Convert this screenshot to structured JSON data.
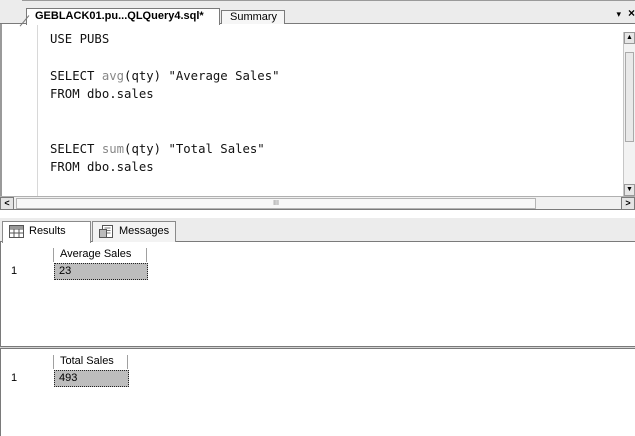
{
  "tabs": {
    "active": "GEBLACK01.pu...QLQuery4.sql*",
    "inactive": "Summary",
    "dropdown_glyph": "▾",
    "close_glyph": "×"
  },
  "editor": {
    "lines": [
      [
        "USE PUBS"
      ],
      [
        ""
      ],
      [
        "SELECT ",
        "avg",
        "(qty) \"Average Sales\""
      ],
      [
        "FROM dbo.sales"
      ],
      [
        ""
      ],
      [
        ""
      ],
      [
        "SELECT ",
        "sum",
        "(qty) \"Total Sales\""
      ],
      [
        "FROM dbo.sales"
      ]
    ]
  },
  "scrollbar": {
    "thumb_grip": "III"
  },
  "results_tabs": {
    "results": "Results",
    "messages": "Messages"
  },
  "result_sets": [
    {
      "column": "Average Sales",
      "row_number": "1",
      "value": "23"
    },
    {
      "column": "Total Sales",
      "row_number": "1",
      "value": "493"
    }
  ]
}
